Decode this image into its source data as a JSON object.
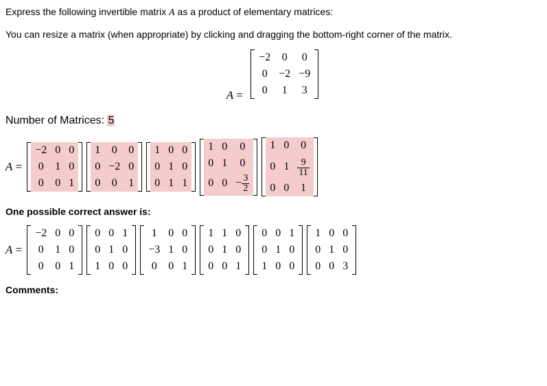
{
  "instruction1": "Express the following invertible matrix ",
  "var_A": "A",
  "instruction1b": " as a product of elementary matrices:",
  "instruction2": "You can resize a matrix (when appropriate) by clicking and dragging the bottom-right corner of the matrix.",
  "matrix_label": "A = ",
  "given_matrix": [
    [
      "-2",
      "0",
      "0"
    ],
    [
      "0",
      "-2",
      "-9"
    ],
    [
      "0",
      "1",
      "3"
    ]
  ],
  "num_matrices_label": "Number of Matrices: ",
  "num_matrices_value": "5",
  "student_answer": {
    "matrices": [
      [
        [
          "-2",
          "0",
          "0"
        ],
        [
          "0",
          "1",
          "0"
        ],
        [
          "0",
          "0",
          "1"
        ]
      ],
      [
        [
          "1",
          "0",
          "0"
        ],
        [
          "0",
          "-2",
          "0"
        ],
        [
          "0",
          "0",
          "1"
        ]
      ],
      [
        [
          "1",
          "0",
          "0"
        ],
        [
          "0",
          "1",
          "0"
        ],
        [
          "0",
          "1",
          "1"
        ]
      ],
      [
        [
          "1",
          "0",
          "0"
        ],
        [
          "0",
          "1",
          "0"
        ],
        [
          "0",
          "0",
          "-3/2"
        ]
      ],
      [
        [
          "1",
          "0",
          "0"
        ],
        [
          "0",
          "1",
          "9/11"
        ],
        [
          "0",
          "0",
          "1"
        ]
      ]
    ],
    "highlighted": [
      true,
      true,
      true,
      true,
      true
    ]
  },
  "correct_label": "One possible correct answer is:",
  "correct_answer": {
    "matrices": [
      [
        [
          "-2",
          "0",
          "0"
        ],
        [
          "0",
          "1",
          "0"
        ],
        [
          "0",
          "0",
          "1"
        ]
      ],
      [
        [
          "0",
          "0",
          "1"
        ],
        [
          "0",
          "1",
          "0"
        ],
        [
          "1",
          "0",
          "0"
        ]
      ],
      [
        [
          "1",
          "0",
          "0"
        ],
        [
          "-3",
          "1",
          "0"
        ],
        [
          "0",
          "0",
          "1"
        ]
      ],
      [
        [
          "1",
          "1",
          "0"
        ],
        [
          "0",
          "1",
          "0"
        ],
        [
          "0",
          "0",
          "1"
        ]
      ],
      [
        [
          "0",
          "0",
          "1"
        ],
        [
          "0",
          "1",
          "0"
        ],
        [
          "1",
          "0",
          "0"
        ]
      ],
      [
        [
          "1",
          "0",
          "0"
        ],
        [
          "0",
          "1",
          "0"
        ],
        [
          "0",
          "0",
          "3"
        ]
      ]
    ]
  },
  "comments_label": "Comments:"
}
